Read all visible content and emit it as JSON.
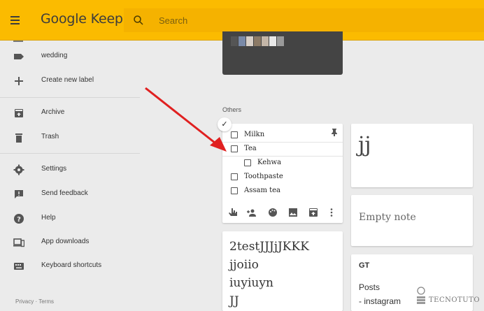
{
  "header": {
    "app_name": "Google Keep",
    "search_placeholder": "Search"
  },
  "sidebar": {
    "items": [
      {
        "label": "wedding",
        "icon": "label-icon"
      },
      {
        "label": "Create new label",
        "icon": "plus-icon"
      },
      {
        "label": "Archive",
        "icon": "archive-icon"
      },
      {
        "label": "Trash",
        "icon": "trash-icon"
      },
      {
        "label": "Settings",
        "icon": "gear-icon"
      },
      {
        "label": "Send feedback",
        "icon": "feedback-icon"
      },
      {
        "label": "Help",
        "icon": "help-icon"
      },
      {
        "label": "App downloads",
        "icon": "devices-icon"
      },
      {
        "label": "Keyboard shortcuts",
        "icon": "keyboard-icon"
      }
    ],
    "footer": {
      "privacy": "Privacy",
      "separator": "·",
      "terms": "Terms"
    }
  },
  "main": {
    "section_label": "Others",
    "checklist_note": {
      "items": [
        {
          "text": "Milkn",
          "checked": false
        },
        {
          "text": "Tea",
          "checked": false
        },
        {
          "text": "Kehwa",
          "checked": false,
          "indent": true
        },
        {
          "text": "Toothpaste",
          "checked": false
        },
        {
          "text": "Assam tea",
          "checked": false
        }
      ],
      "toolbar_icons": [
        "reminder-icon",
        "collaborator-icon",
        "palette-icon",
        "image-icon",
        "archive-icon",
        "more-icon"
      ]
    },
    "note_jj": {
      "text": "jj"
    },
    "note_empty": {
      "text": "Empty note"
    },
    "note_text": {
      "lines": [
        "2testJJJjJKKK",
        "jjoiio",
        "iuyiuyn",
        "JJ"
      ]
    },
    "note_gt": {
      "title": "GT",
      "lines": [
        "Posts",
        "- instagram"
      ]
    }
  },
  "watermark": "TECNOTUTO",
  "colors": {
    "header": "#fbbb00",
    "accent_arrow": "#e02020",
    "background": "#ebebeb"
  }
}
